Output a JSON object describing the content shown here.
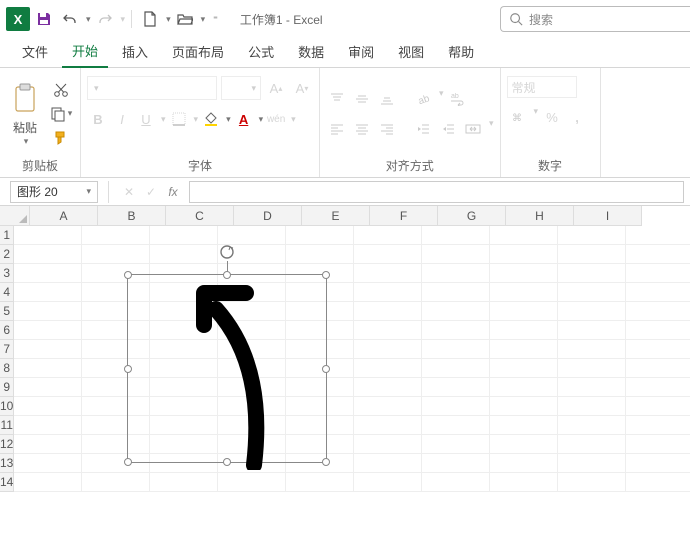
{
  "title": "工作簿1 - Excel",
  "search_placeholder": "搜索",
  "tabs": {
    "file": "文件",
    "home": "开始",
    "insert": "插入",
    "layout": "页面布局",
    "formulas": "公式",
    "data": "数据",
    "review": "审阅",
    "view": "视图",
    "help": "帮助"
  },
  "ribbon": {
    "clipboard": {
      "paste": "粘贴",
      "label": "剪贴板"
    },
    "font": {
      "label": "字体",
      "bold": "B",
      "italic": "I",
      "underline": "U",
      "phonetic": "wén"
    },
    "align": {
      "label": "对齐方式"
    },
    "number": {
      "label": "数字",
      "format": "常规",
      "percent": "%"
    }
  },
  "namebox": "图形 20",
  "fx_label": "fx",
  "columns": [
    "A",
    "B",
    "C",
    "D",
    "E",
    "F",
    "G",
    "H",
    "I"
  ],
  "rows": [
    "1",
    "2",
    "3",
    "4",
    "5",
    "6",
    "7",
    "8",
    "9",
    "10",
    "11",
    "12",
    "13",
    "14"
  ]
}
